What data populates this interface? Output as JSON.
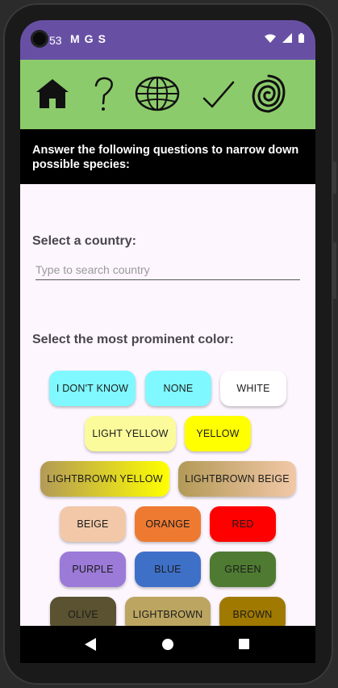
{
  "status_bar": {
    "time": "53",
    "notification_icons": [
      "gmail-icon",
      "google-icon",
      "sync-icon"
    ],
    "right_icons": [
      "wifi-icon",
      "signal-icon",
      "battery-icon"
    ]
  },
  "toolbar": {
    "icons": [
      "home-icon",
      "help-question-icon",
      "globe-icon",
      "checkmark-icon",
      "spiral-logo-icon"
    ]
  },
  "prompt": {
    "text": "Answer the following questions to narrow down possible species:"
  },
  "country": {
    "heading": "Select a country:",
    "placeholder": "Type to search country",
    "value": ""
  },
  "color": {
    "heading": "Select the most prominent color:",
    "options": [
      {
        "label": "I DON'T KNOW",
        "bg": "#80f8ff",
        "fg": "#1c1c1c"
      },
      {
        "label": "NONE",
        "bg": "#80f8ff",
        "fg": "#1c1c1c"
      },
      {
        "label": "WHITE",
        "bg": "#ffffff",
        "fg": "#1c1c1c"
      },
      {
        "label": "LIGHT YELLOW",
        "bg": "#fbfb9c",
        "fg": "#1c1c1c"
      },
      {
        "label": "YELLOW",
        "bg": "#ffff00",
        "fg": "#1c1c1c"
      },
      {
        "label": "LIGHTBROWN YELLOW",
        "bg": "linear-gradient(90deg,#b39a57,#ffff00)",
        "fg": "#1c1c1c"
      },
      {
        "label": "LIGHTBROWN BEIGE",
        "bg": "linear-gradient(90deg,#b39a57,#f2c8a8)",
        "fg": "#1c1c1c"
      },
      {
        "label": "BEIGE",
        "bg": "#f2c8a8",
        "fg": "#1c1c1c"
      },
      {
        "label": "ORANGE",
        "bg": "#ee7a32",
        "fg": "#1c1c1c"
      },
      {
        "label": "RED",
        "bg": "#ff0000",
        "fg": "#1c1c1c"
      },
      {
        "label": "PURPLE",
        "bg": "#9b7ad8",
        "fg": "#1c1c1c"
      },
      {
        "label": "BLUE",
        "bg": "#3e70c8",
        "fg": "#1c1c1c"
      },
      {
        "label": "GREEN",
        "bg": "#4e7b31",
        "fg": "#1c1c1c"
      },
      {
        "label": "OLIVE",
        "bg": "#5a5230",
        "fg": "#1c1c1c"
      },
      {
        "label": "LIGHTBROWN",
        "bg": "#bba561",
        "fg": "#1c1c1c"
      },
      {
        "label": "BROWN",
        "bg": "#a07900",
        "fg": "#1c1c1c"
      },
      {
        "label": "",
        "bg": "#7a6420",
        "fg": "#1c1c1c"
      },
      {
        "label": "",
        "bg": "#000000",
        "fg": "#ffffff"
      },
      {
        "label": "",
        "bg": "#808080",
        "fg": "#1c1c1c"
      }
    ]
  },
  "nav_bar": {
    "icons": [
      "back-icon",
      "home-circle-icon",
      "recents-icon"
    ]
  }
}
